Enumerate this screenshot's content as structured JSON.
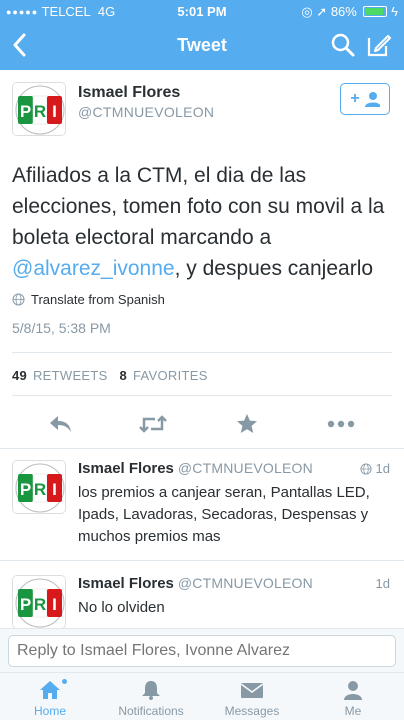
{
  "status_bar": {
    "carrier": "TELCEL",
    "network": "4G",
    "time": "5:01 PM",
    "battery": "86%",
    "battery_level": 0.86
  },
  "nav": {
    "title": "Tweet"
  },
  "tweet": {
    "name": "Ismael Flores",
    "handle": "@CTMNUEVOLEON",
    "follow_label": "+",
    "text_before": "Afiliados a la CTM, el dia de las elecciones, tomen foto con su movil a la boleta electoral marcando a ",
    "mention": "@alvarez_ivonne",
    "text_after": ", y despues canjearlo",
    "translate": "Translate from Spanish",
    "date": "5/8/15, 5:38 PM",
    "retweets_count": "49",
    "retweets_label": "RETWEETS",
    "favorites_count": "8",
    "favorites_label": "FAVORITES",
    "avatar_text": "PRI"
  },
  "replies": [
    {
      "name": "Ismael Flores",
      "handle": "@CTMNUEVOLEON",
      "time": "1d",
      "text": "los premios a canjear seran, Pantallas LED, Ipads, Lavadoras, Secadoras, Despensas y muchos premios mas"
    },
    {
      "name": "Ismael Flores",
      "handle": "@CTMNUEVOLEON",
      "time": "1d",
      "text": "No lo olviden"
    }
  ],
  "compose": {
    "placeholder": "Reply to Ismael Flores, Ivonne Alvarez"
  },
  "tabs": [
    {
      "label": "Home",
      "icon": "home-icon"
    },
    {
      "label": "Notifications",
      "icon": "bell-icon"
    },
    {
      "label": "Messages",
      "icon": "envelope-icon"
    },
    {
      "label": "Me",
      "icon": "person-icon"
    }
  ],
  "colors": {
    "accent": "#55acee",
    "text": "#292f33",
    "muted": "#8899a6"
  }
}
